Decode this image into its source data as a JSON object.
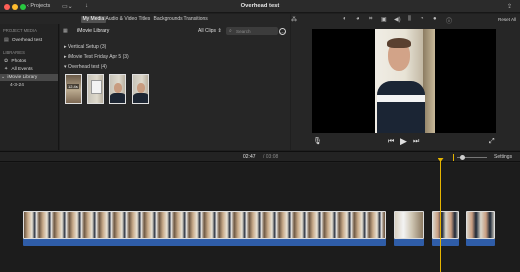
{
  "window": {
    "title": "Overhead test",
    "projects_label": "Projects",
    "traffic_lights": [
      "#ff5f57",
      "#febc2e",
      "#28c840"
    ]
  },
  "media_tabs": [
    {
      "label": "My Media",
      "active": true
    },
    {
      "label": "Audio & Video",
      "active": false
    },
    {
      "label": "Titles",
      "active": false
    },
    {
      "label": "Backgrounds",
      "active": false
    },
    {
      "label": "Transitions",
      "active": false
    }
  ],
  "sidebar": {
    "project_media_heading": "PROJECT MEDIA",
    "project_item": "Overhead test",
    "libraries_heading": "LIBRARIES",
    "photos": "Photos",
    "all_events": "All Events",
    "library": "iMovie Library",
    "event": "4-3-24"
  },
  "browser": {
    "library_title": "iMovie Library",
    "filter": "All Clips",
    "search_placeholder": "Search",
    "events": [
      {
        "label": "Vertical Setup",
        "count": "(3)",
        "expanded": false
      },
      {
        "label": "iMovie Test Friday Apr 5",
        "count": "(3)",
        "expanded": false
      },
      {
        "label": "Overhead test",
        "count": "(4)",
        "expanded": true
      }
    ],
    "first_clip_duration": "12.4s"
  },
  "viewer": {
    "reset_label": "Reset All"
  },
  "timeline": {
    "current_time": "02:47",
    "total_time": "/ 03:08",
    "settings_label": "Settings"
  },
  "colors": {
    "accent_playhead": "#e5b400",
    "audio_track": "#2f5da8",
    "selection": "#4a4a4a"
  }
}
